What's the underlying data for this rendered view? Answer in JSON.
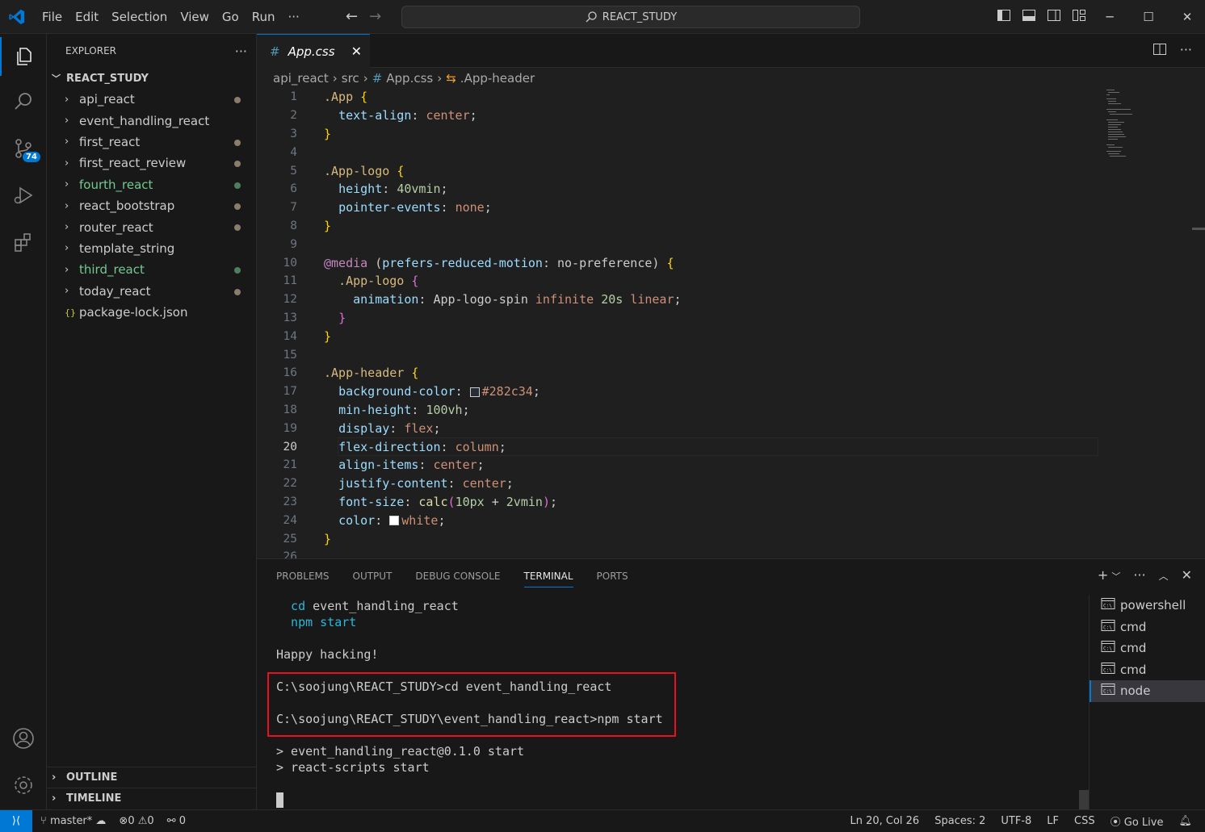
{
  "menu": [
    "File",
    "Edit",
    "Selection",
    "View",
    "Go",
    "Run",
    "···"
  ],
  "search": {
    "text": "REACT_STUDY"
  },
  "activity": {
    "scm_badge": "74"
  },
  "explorer": {
    "title": "EXPLORER",
    "more": "···",
    "root": "REACT_STUDY",
    "items": [
      {
        "label": "api_react",
        "color": "#cccccc",
        "dot": "#8a7d6b"
      },
      {
        "label": "event_handling_react",
        "color": "#cccccc",
        "dot": ""
      },
      {
        "label": "first_react",
        "color": "#cccccc",
        "dot": "#8a7d6b"
      },
      {
        "label": "first_react_review",
        "color": "#cccccc",
        "dot": "#8a7d6b"
      },
      {
        "label": "fourth_react",
        "color": "#73c991",
        "dot": "#4f7d5f"
      },
      {
        "label": "react_bootstrap",
        "color": "#cccccc",
        "dot": "#8a7d6b"
      },
      {
        "label": "router_react",
        "color": "#cccccc",
        "dot": "#8a7d6b"
      },
      {
        "label": "template_string",
        "color": "#cccccc",
        "dot": ""
      },
      {
        "label": "third_react",
        "color": "#73c991",
        "dot": "#4f7d5f"
      },
      {
        "label": "today_react",
        "color": "#cccccc",
        "dot": "#8a7d6b"
      },
      {
        "label": "package-lock.json",
        "color": "#cccccc",
        "dot": "",
        "file": true
      }
    ],
    "outline": "OUTLINE",
    "timeline": "TIMELINE"
  },
  "editor": {
    "tab_label": "App.css",
    "breadcrumb": [
      "api_react",
      "src",
      "App.css",
      ".App-header"
    ],
    "current_line": 20,
    "line_numbers": [
      "1",
      "2",
      "3",
      "4",
      "5",
      "6",
      "7",
      "8",
      "9",
      "10",
      "11",
      "12",
      "13",
      "14",
      "15",
      "16",
      "17",
      "18",
      "19",
      "20",
      "21",
      "22",
      "23",
      "24",
      "25",
      "26"
    ]
  },
  "panel": {
    "tabs": [
      "PROBLEMS",
      "OUTPUT",
      "DEBUG CONSOLE",
      "TERMINAL",
      "PORTS"
    ],
    "active_tab": "TERMINAL",
    "terminal_lines": {
      "l1a": "  cd",
      "l1b": " event_handling_react",
      "l2a": "  npm",
      "l2b": " start",
      "l3": "Happy hacking!",
      "l4": "C:\\soojung\\REACT_STUDY>cd event_handling_react",
      "l5": "C:\\soojung\\REACT_STUDY\\event_handling_react>npm start",
      "l6": "> event_handling_react@0.1.0 start",
      "l7": "> react-scripts start"
    },
    "terminals": [
      "powershell",
      "cmd",
      "cmd",
      "cmd",
      "node"
    ],
    "active_terminal": "node"
  },
  "status": {
    "branch": "master*",
    "errors": "0",
    "warnings": "0",
    "ports": "0",
    "position": "Ln 20, Col 26",
    "spaces": "Spaces: 2",
    "encoding": "UTF-8",
    "eol": "LF",
    "language": "CSS",
    "golive": "Go Live"
  }
}
